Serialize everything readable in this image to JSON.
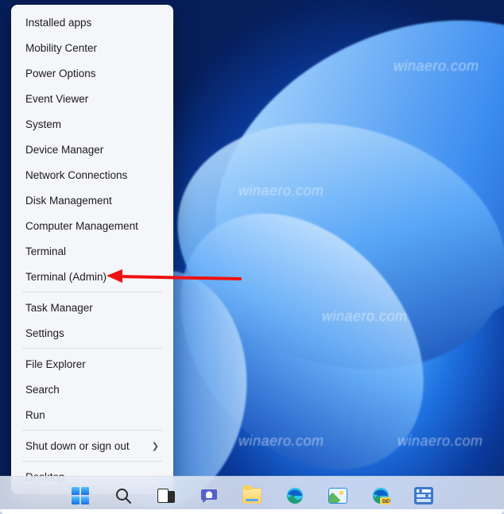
{
  "winx_menu": {
    "groups": [
      {
        "items": [
          {
            "label": "Installed apps",
            "name": "menu-installed-apps"
          },
          {
            "label": "Mobility Center",
            "name": "menu-mobility-center"
          },
          {
            "label": "Power Options",
            "name": "menu-power-options"
          },
          {
            "label": "Event Viewer",
            "name": "menu-event-viewer"
          },
          {
            "label": "System",
            "name": "menu-system"
          },
          {
            "label": "Device Manager",
            "name": "menu-device-manager"
          },
          {
            "label": "Network Connections",
            "name": "menu-network-connections"
          },
          {
            "label": "Disk Management",
            "name": "menu-disk-management"
          },
          {
            "label": "Computer Management",
            "name": "menu-computer-management"
          },
          {
            "label": "Terminal",
            "name": "menu-terminal"
          },
          {
            "label": "Terminal (Admin)",
            "name": "menu-terminal-admin",
            "highlighted": true
          }
        ]
      },
      {
        "items": [
          {
            "label": "Task Manager",
            "name": "menu-task-manager"
          },
          {
            "label": "Settings",
            "name": "menu-settings"
          }
        ]
      },
      {
        "items": [
          {
            "label": "File Explorer",
            "name": "menu-file-explorer"
          },
          {
            "label": "Search",
            "name": "menu-search"
          },
          {
            "label": "Run",
            "name": "menu-run"
          }
        ]
      },
      {
        "items": [
          {
            "label": "Shut down or sign out",
            "name": "menu-shutdown-signout",
            "has_submenu": true
          }
        ]
      },
      {
        "items": [
          {
            "label": "Desktop",
            "name": "menu-desktop"
          }
        ]
      }
    ]
  },
  "taskbar": {
    "buttons": [
      {
        "name": "start-button",
        "icon": "windows-logo-icon"
      },
      {
        "name": "search-button",
        "icon": "search-icon"
      },
      {
        "name": "task-view-button",
        "icon": "task-view-icon"
      },
      {
        "name": "chat-button",
        "icon": "chat-icon"
      },
      {
        "name": "file-explorer-button",
        "icon": "folder-icon"
      },
      {
        "name": "edge-button",
        "icon": "edge-icon"
      },
      {
        "name": "photos-button",
        "icon": "photos-icon"
      },
      {
        "name": "edge-dev-button",
        "icon": "edge-dev-icon"
      },
      {
        "name": "settings-app-button",
        "icon": "settings-panel-icon"
      }
    ]
  },
  "annotation": {
    "target_item": "Terminal (Admin)",
    "arrow_color": "#e11"
  },
  "watermark_text": "winaero.com"
}
